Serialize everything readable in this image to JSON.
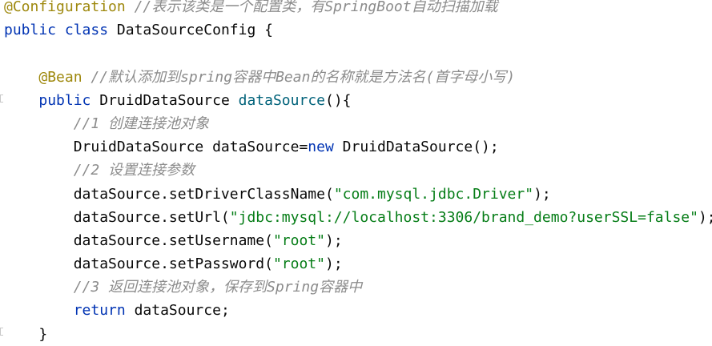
{
  "colors": {
    "keyword": "#0033b3",
    "annotation": "#9e880d",
    "comment": "#8c8c8c",
    "string": "#067d17",
    "method_decl": "#00627a",
    "text": "#080808",
    "background": "#ffffff"
  },
  "lines": [
    [
      {
        "t": "ann",
        "s": "@Configuration"
      },
      {
        "t": "plain",
        "s": " "
      },
      {
        "t": "cmt",
        "s": "//表示该类是一个配置类，有SpringBoot自动扫描加载"
      }
    ],
    [
      {
        "t": "kw",
        "s": "public"
      },
      {
        "t": "plain",
        "s": " "
      },
      {
        "t": "kw",
        "s": "class"
      },
      {
        "t": "plain",
        "s": " DataSourceConfig {"
      }
    ],
    [],
    [
      {
        "t": "plain",
        "s": "    "
      },
      {
        "t": "ann",
        "s": "@Bean"
      },
      {
        "t": "plain",
        "s": " "
      },
      {
        "t": "cmt",
        "s": "//默认添加到spring容器中Bean的名称就是方法名(首字母小写)"
      }
    ],
    [
      {
        "t": "plain",
        "s": "    "
      },
      {
        "t": "kw",
        "s": "public"
      },
      {
        "t": "plain",
        "s": " DruidDataSource "
      },
      {
        "t": "method",
        "s": "dataSource"
      },
      {
        "t": "plain",
        "s": "(){"
      }
    ],
    [
      {
        "t": "plain",
        "s": "        "
      },
      {
        "t": "cmt",
        "s": "//1 创建连接池对象"
      }
    ],
    [
      {
        "t": "plain",
        "s": "        DruidDataSource dataSource="
      },
      {
        "t": "kw",
        "s": "new"
      },
      {
        "t": "plain",
        "s": " DruidDataSource();"
      }
    ],
    [
      {
        "t": "plain",
        "s": "        "
      },
      {
        "t": "cmt",
        "s": "//2 设置连接参数"
      }
    ],
    [
      {
        "t": "plain",
        "s": "        dataSource.setDriverClassName("
      },
      {
        "t": "str",
        "s": "\"com.mysql.jdbc.Driver\""
      },
      {
        "t": "plain",
        "s": ");"
      }
    ],
    [
      {
        "t": "plain",
        "s": "        dataSource.setUrl("
      },
      {
        "t": "str",
        "s": "\"jdbc:mysql://localhost:3306/brand_demo?userSSL=false\""
      },
      {
        "t": "plain",
        "s": ");"
      }
    ],
    [
      {
        "t": "plain",
        "s": "        dataSource.setUsername("
      },
      {
        "t": "str",
        "s": "\"root\""
      },
      {
        "t": "plain",
        "s": ");"
      }
    ],
    [
      {
        "t": "plain",
        "s": "        dataSource.setPassword("
      },
      {
        "t": "str",
        "s": "\"root\""
      },
      {
        "t": "plain",
        "s": ");"
      }
    ],
    [
      {
        "t": "plain",
        "s": "        "
      },
      {
        "t": "cmt",
        "s": "//3 返回连接池对象，保存到Spring容器中"
      }
    ],
    [
      {
        "t": "plain",
        "s": "        "
      },
      {
        "t": "kw",
        "s": "return"
      },
      {
        "t": "plain",
        "s": " dataSource;"
      }
    ],
    [
      {
        "t": "plain",
        "s": "    }"
      }
    ]
  ]
}
